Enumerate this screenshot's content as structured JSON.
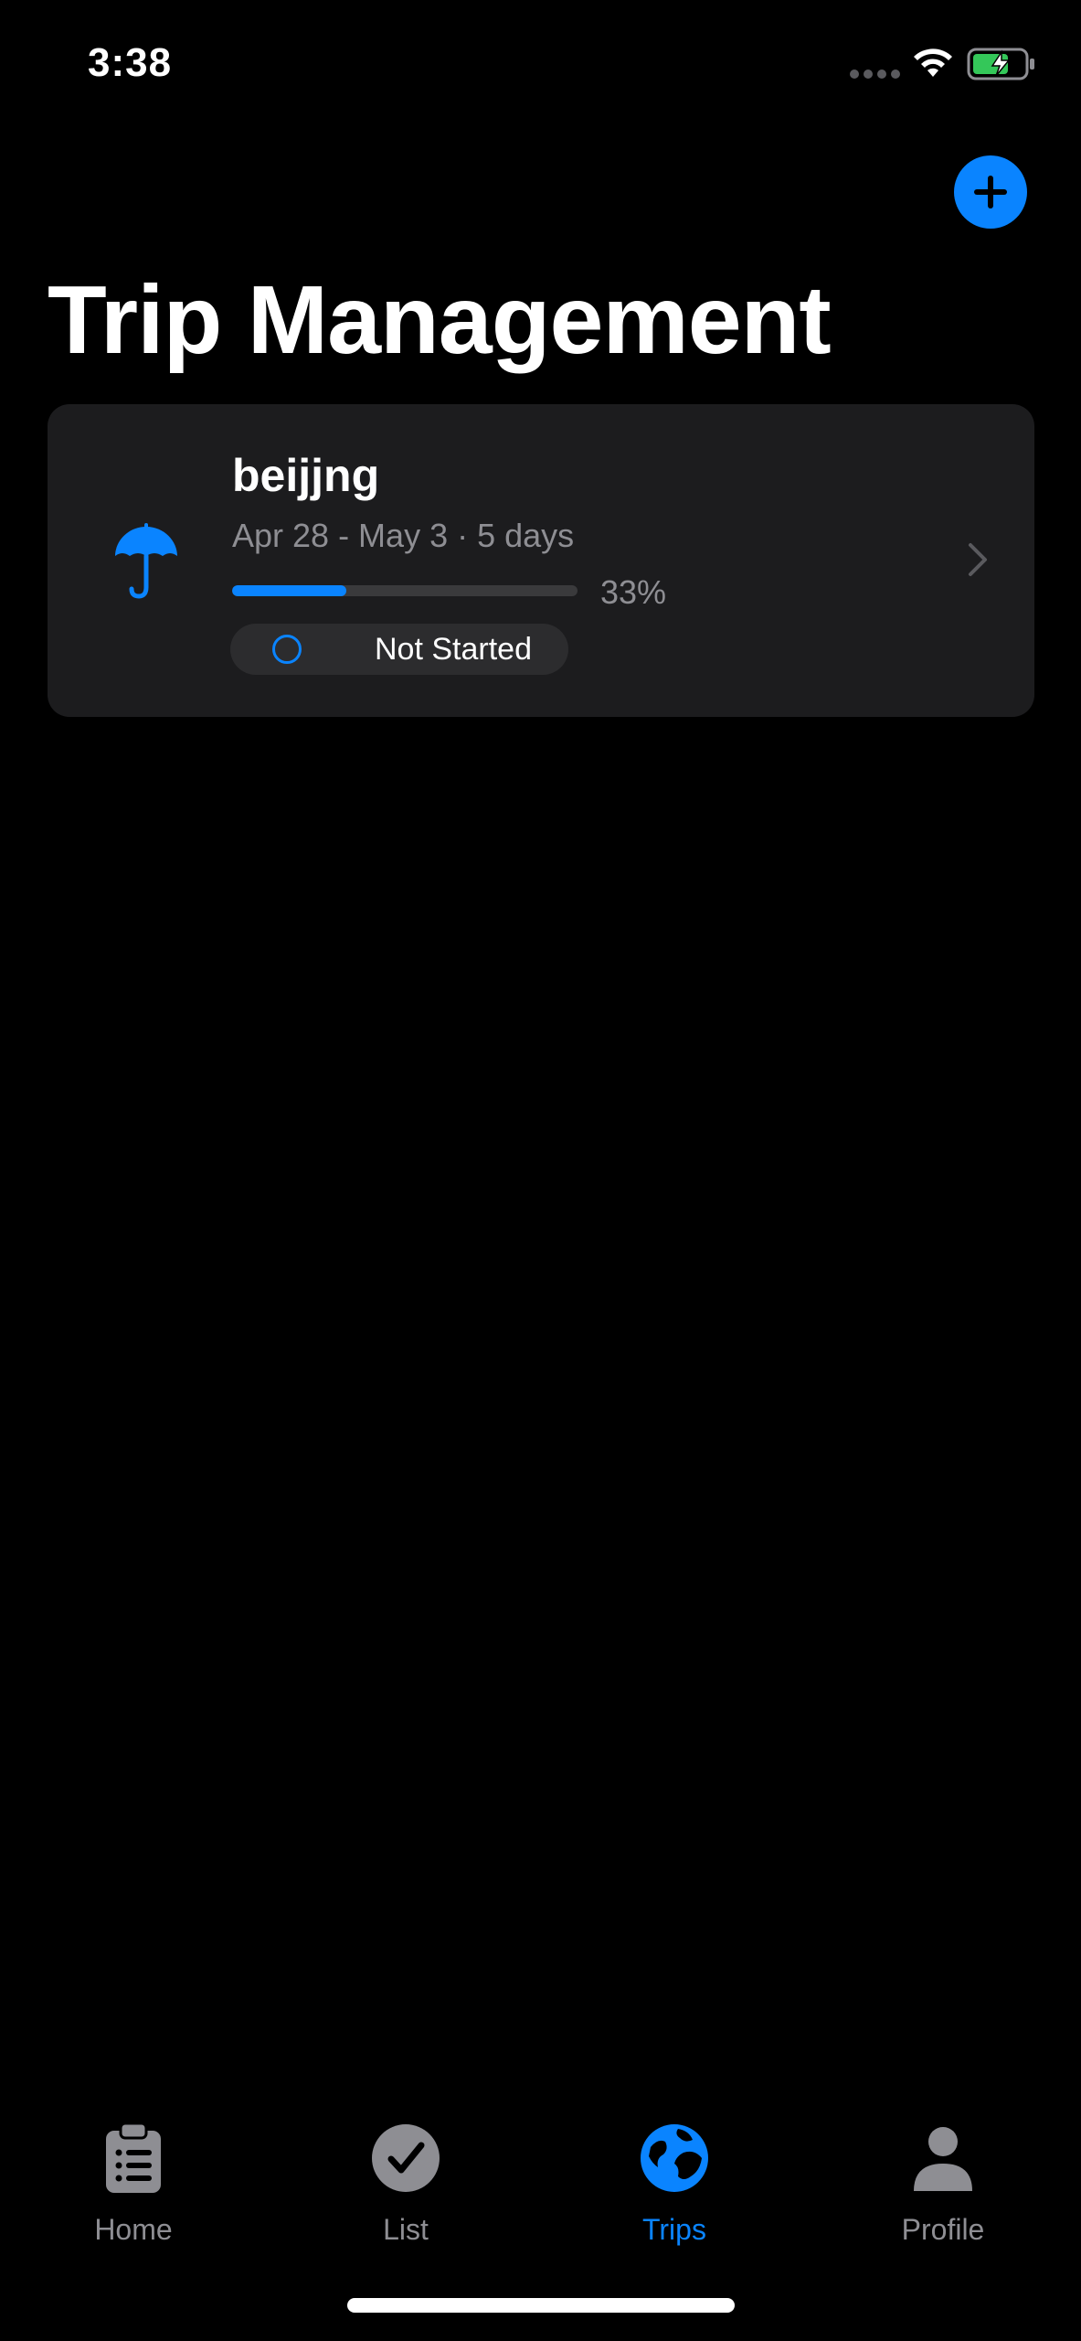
{
  "status_bar": {
    "time": "3:38"
  },
  "header": {
    "title": "Trip Management",
    "add_icon": "plus-icon"
  },
  "trips": [
    {
      "name": "beijjng",
      "dates": "Apr 28 - May 3 · 5 days",
      "progress": 0.33,
      "progress_label": "33%",
      "status": "Not Started",
      "icon": "umbrella-icon"
    }
  ],
  "tab_bar": {
    "tabs": [
      {
        "label": "Home",
        "icon": "clipboard-icon",
        "active": false
      },
      {
        "label": "List",
        "icon": "checkmark-circle-icon",
        "active": false
      },
      {
        "label": "Trips",
        "icon": "globe-icon",
        "active": true
      },
      {
        "label": "Profile",
        "icon": "person-icon",
        "active": false
      }
    ]
  },
  "colors": {
    "accent": "#0a84ff",
    "background": "#000000",
    "card": "#1c1c1e",
    "secondary_text": "#8e8e93",
    "battery": "#34c759"
  }
}
